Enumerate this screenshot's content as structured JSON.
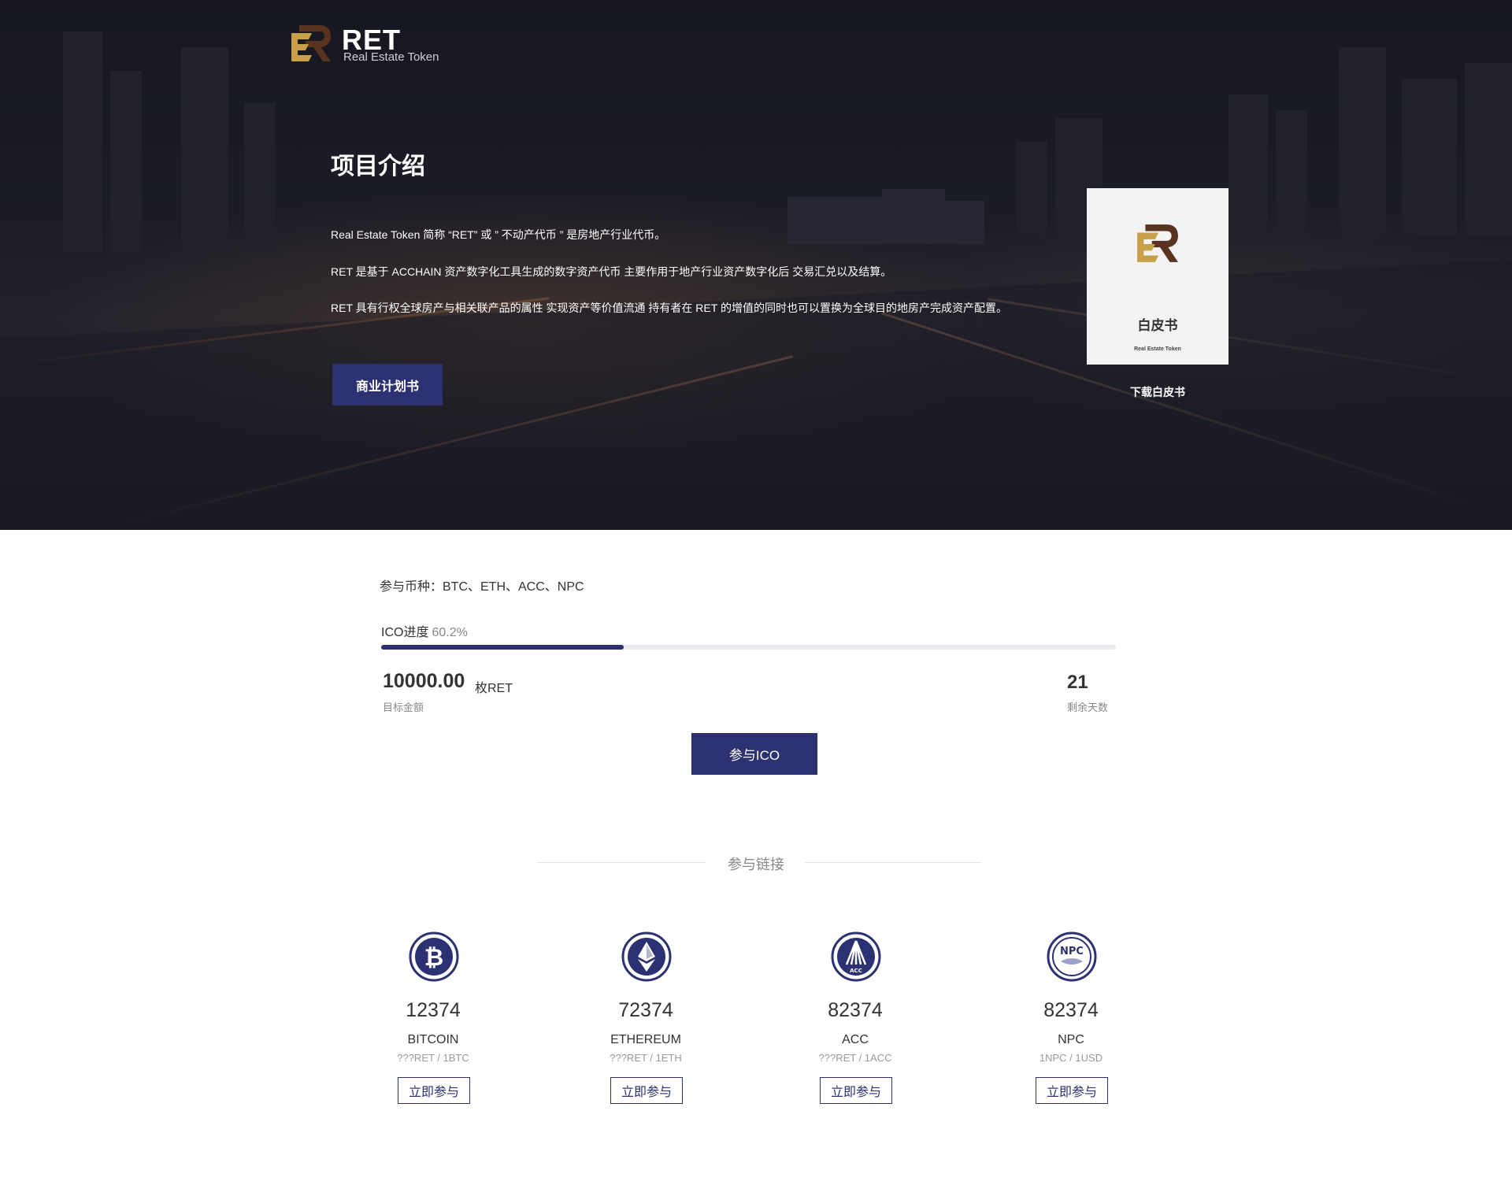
{
  "logo": {
    "title": "RET",
    "subtitle": "Real Estate Token"
  },
  "intro": {
    "title": "项目介绍",
    "paragraphs": [
      "Real Estate Token 简称 “RET” 或 ” 不动产代币 ” 是房地产行业代币。",
      "RET 是基于 ACCHAIN 资产数字化工具生成的数字资产代币 主要作用于地产行业资产数字化后 交易汇兑以及结算。",
      "RET 具有行权全球房产与相关联产品的属性 实现资产等价值流通 持有者在 RET 的增值的同时也可以置换为全球目的地房产完成资产配置。"
    ],
    "business_plan_label": "商业计划书"
  },
  "whitepaper": {
    "card_title": "白皮书",
    "card_subtitle": "Real Estate Token",
    "download_label": "下载白皮书"
  },
  "ico": {
    "currencies_text": "参与币种：BTC、ETH、ACC、NPC",
    "progress_label": "ICO进度",
    "progress_value_text": "60.2%",
    "progress_fraction": 0.33,
    "target_amount": "10000.00",
    "target_unit": "枚RET",
    "target_label": "目标金额",
    "days_remaining": "21",
    "days_label": "剩余天数",
    "join_label": "参与ICO"
  },
  "links": {
    "title": "参与链接",
    "coins": [
      {
        "icon": "bitcoin-icon",
        "count": "12374",
        "name": "BITCOIN",
        "rate": "???RET / 1BTC",
        "button": "立即参与"
      },
      {
        "icon": "ethereum-icon",
        "count": "72374",
        "name": "ETHEREUM",
        "rate": "???RET / 1ETH",
        "button": "立即参与"
      },
      {
        "icon": "acc-icon",
        "count": "82374",
        "name": "ACC",
        "rate": "???RET / 1ACC",
        "button": "立即参与"
      },
      {
        "icon": "npc-icon",
        "count": "82374",
        "name": "NPC",
        "rate": "1NPC / 1USD",
        "button": "立即参与"
      }
    ]
  },
  "colors": {
    "accent": "#2c3271",
    "hero_bg": "#1b1c26",
    "gold": "#c9a04a",
    "brown": "#5a3220"
  }
}
